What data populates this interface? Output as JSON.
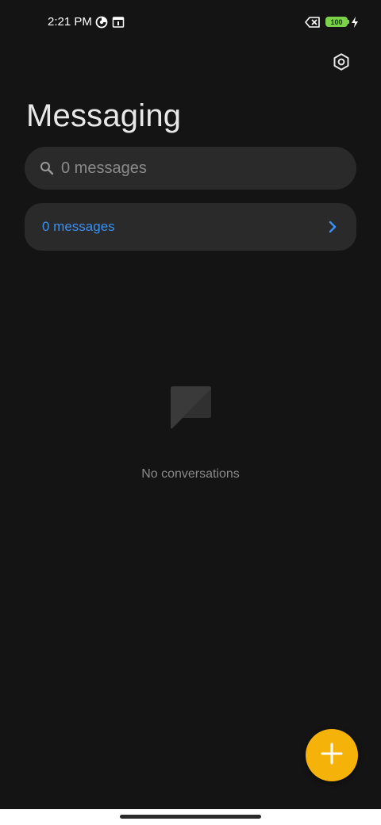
{
  "status_bar": {
    "time": "2:21 PM",
    "battery_level": "100",
    "icons": [
      "data-saver-icon",
      "calendar-icon",
      "no-sim-icon",
      "battery-icon",
      "charging-icon"
    ]
  },
  "header": {
    "title": "Messaging",
    "settings_icon": "settings-icon"
  },
  "search": {
    "placeholder": "0 messages",
    "value": ""
  },
  "messages_card": {
    "label": "0 messages",
    "label_color": "#3a8ff0"
  },
  "empty_state": {
    "text": "No conversations",
    "icon": "chat-bubble-icon"
  },
  "fab": {
    "icon": "plus-icon",
    "color": "#f5b30a"
  },
  "colors": {
    "background": "#141414",
    "surface": "#2a2a2a",
    "accent": "#3a8ff0",
    "fab": "#f5b30a"
  }
}
